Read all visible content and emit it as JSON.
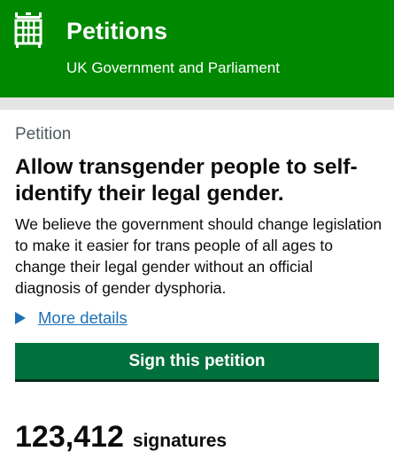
{
  "header": {
    "logo_icon": "portcullis-icon",
    "title": "Petitions",
    "subtitle": "UK Government and Parliament",
    "brand_color": "#008800"
  },
  "petition": {
    "label": "Petition",
    "title": "Allow transgender people to self-identify their legal gender.",
    "description": "We believe the government should change legislation to make it easier for trans people of all ages to change their legal gender without an official diagnosis of gender dysphoria.",
    "details_link": "More details",
    "sign_button": "Sign this petition",
    "signature_count": "123,412",
    "signature_word": "signatures",
    "button_color": "#00703c",
    "link_color": "#1d70b8"
  }
}
